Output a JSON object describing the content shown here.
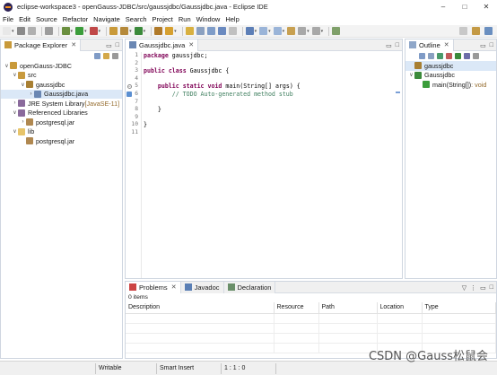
{
  "window": {
    "title": "eclipse-workspace3 - openGauss-JDBC/src/gaussjdbc/Gaussjdbc.java - Eclipse IDE",
    "controls": [
      "–",
      "□",
      "✕"
    ]
  },
  "menu": [
    "File",
    "Edit",
    "Source",
    "Refactor",
    "Navigate",
    "Search",
    "Project",
    "Run",
    "Window",
    "Help"
  ],
  "toolbar": {
    "icons": [
      {
        "name": "new-icon",
        "color": "#e8e8e8",
        "dd": true
      },
      {
        "name": "save-icon",
        "color": "#8a8a8a"
      },
      {
        "name": "save-all-icon",
        "color": "#b0b0b0"
      },
      {
        "sep": true
      },
      {
        "name": "print-icon",
        "color": "#9c9c9c"
      },
      {
        "sep": true
      },
      {
        "name": "debug-icon",
        "color": "#6a8f3f",
        "dd": true
      },
      {
        "name": "run-icon",
        "color": "#3b9d3b",
        "dd": true
      },
      {
        "name": "coverage-icon",
        "color": "#c04848",
        "dd": true
      },
      {
        "sep": true
      },
      {
        "name": "new-java-project-icon",
        "color": "#c99a3a"
      },
      {
        "name": "new-package-icon",
        "color": "#b5893a",
        "dd": true
      },
      {
        "name": "new-class-icon",
        "color": "#3b8a3b",
        "dd": true
      },
      {
        "sep": true
      },
      {
        "name": "open-type-icon",
        "color": "#b07a2a"
      },
      {
        "name": "open-task-icon",
        "color": "#d6a030",
        "dd": true
      },
      {
        "sep": true
      },
      {
        "name": "toggle-mark-occurrences-icon",
        "color": "#d8b040"
      },
      {
        "name": "pin-icon",
        "color": "#8aa0c0"
      },
      {
        "name": "block-selection-icon",
        "color": "#7e9cc8"
      },
      {
        "name": "word-wrap-icon",
        "color": "#6a8ac0"
      },
      {
        "name": "show-whitespace-icon",
        "color": "#c0c0c0"
      },
      {
        "sep": true
      },
      {
        "name": "search-icon",
        "color": "#5d7fb7",
        "dd": true
      },
      {
        "name": "next-annotation-icon",
        "color": "#9ab4d8",
        "dd": true
      },
      {
        "name": "prev-annotation-icon",
        "color": "#9ab4d8",
        "dd": true
      },
      {
        "name": "last-edit-icon",
        "color": "#c8a050"
      },
      {
        "name": "back-icon",
        "color": "#a8a8a8",
        "dd": true
      },
      {
        "name": "forward-icon",
        "color": "#a8a8a8",
        "dd": true
      },
      {
        "sep": true
      },
      {
        "name": "open-perspective-icon",
        "color": "#7fa06a"
      }
    ],
    "right_icons": [
      {
        "name": "search-field-icon",
        "color": "#c8c8c8"
      },
      {
        "name": "java-perspective-icon",
        "color": "#c49a45"
      },
      {
        "name": "debug-perspective-icon",
        "color": "#6a8fc0"
      }
    ]
  },
  "package_explorer": {
    "tab_label": "Package Explorer",
    "tree": [
      {
        "depth": 0,
        "twisty": "∨",
        "icon": "java-project-icon",
        "icon_color": "#c99a3a",
        "label": "openGauss-JDBC",
        "suffix": ""
      },
      {
        "depth": 1,
        "twisty": "∨",
        "icon": "source-folder-icon",
        "icon_color": "#c89a3e",
        "label": "src",
        "suffix": ""
      },
      {
        "depth": 2,
        "twisty": "∨",
        "icon": "package-icon",
        "icon_color": "#a87f32",
        "label": "gaussjdbc",
        "suffix": ""
      },
      {
        "depth": 3,
        "twisty": "›",
        "icon": "java-file-icon",
        "icon_color": "#6a87b3",
        "label": "Gaussjdbc.java",
        "suffix": "",
        "selected": true
      },
      {
        "depth": 1,
        "twisty": "›",
        "icon": "library-icon",
        "icon_color": "#8a6a9c",
        "label": "JRE System Library",
        "suffix": " [JavaSE-11]"
      },
      {
        "depth": 1,
        "twisty": "∨",
        "icon": "library-icon",
        "icon_color": "#8a6a9c",
        "label": "Referenced Libraries",
        "suffix": ""
      },
      {
        "depth": 2,
        "twisty": "›",
        "icon": "jar-icon",
        "icon_color": "#b08850",
        "label": "postgresql.jar",
        "suffix": ""
      },
      {
        "depth": 1,
        "twisty": "∨",
        "icon": "folder-icon",
        "icon_color": "#e7c46a",
        "label": "lib",
        "suffix": ""
      },
      {
        "depth": 2,
        "twisty": "",
        "icon": "jar-icon",
        "icon_color": "#b08850",
        "label": "postgresql.jar",
        "suffix": ""
      }
    ]
  },
  "editor": {
    "tab_label": "Gaussjdbc.java",
    "lines": [
      [
        [
          "kw",
          "package"
        ],
        [
          "t",
          " gaussjdbc;"
        ]
      ],
      [],
      [
        [
          "kw",
          "public"
        ],
        [
          "t",
          " "
        ],
        [
          "kw",
          "class"
        ],
        [
          "t",
          " Gaussjdbc {"
        ]
      ],
      [],
      [
        [
          "t",
          "    "
        ],
        [
          "kw",
          "public"
        ],
        [
          "t",
          " "
        ],
        [
          "kw",
          "static"
        ],
        [
          "t",
          " "
        ],
        [
          "kw",
          "void"
        ],
        [
          "t",
          " main(String[] args) {"
        ]
      ],
      [
        [
          "cm",
          "        // TODO Auto-generated method stub"
        ]
      ],
      [],
      [
        [
          "t",
          "    }"
        ]
      ],
      [],
      [
        [
          "t",
          "}"
        ]
      ],
      []
    ],
    "line_numbers": [
      "1",
      "2",
      "3",
      "4",
      "5",
      "6",
      "7",
      "8",
      "9",
      "10",
      "11"
    ]
  },
  "outline": {
    "tab_label": "Outline",
    "items": [
      {
        "depth": 0,
        "twisty": "",
        "icon": "package-icon",
        "icon_color": "#a87f32",
        "label": "gaussjdbc",
        "selected": true,
        "suffix": ""
      },
      {
        "depth": 0,
        "twisty": "∨",
        "icon": "class-icon",
        "icon_color": "#3b8a3b",
        "label": "Gaussjdbc",
        "suffix": ""
      },
      {
        "depth": 1,
        "twisty": "",
        "icon": "method-icon",
        "icon_color": "#3b9d3b",
        "label": "main(String[])",
        "suffix": " : void"
      }
    ]
  },
  "bottom": {
    "tabs": [
      {
        "label": "Problems",
        "icon": "problems-icon",
        "color": "#c44",
        "active": true
      },
      {
        "label": "Javadoc",
        "icon": "javadoc-icon",
        "color": "#5a7fb5"
      },
      {
        "label": "Declaration",
        "icon": "declaration-icon",
        "color": "#6a8f6a"
      }
    ],
    "count": "0 items",
    "columns": [
      "Description",
      "Resource",
      "Path",
      "Location",
      "Type"
    ]
  },
  "status": {
    "mode": "Writable",
    "insert": "Smart Insert",
    "position": "1 : 1 : 0"
  },
  "watermark": "CSDN @Gauss松鼠会"
}
